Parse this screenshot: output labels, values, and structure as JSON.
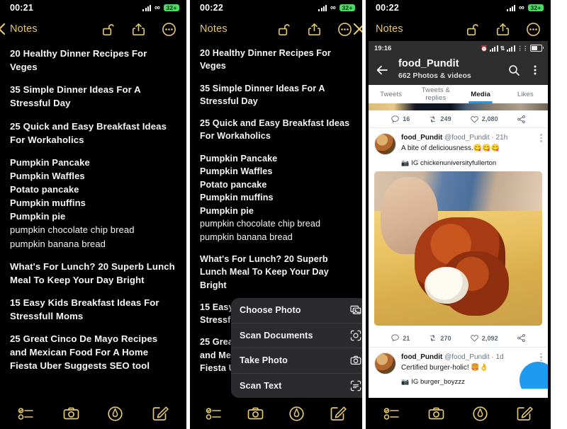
{
  "panels": [
    {
      "id": "panel-1",
      "status": {
        "time": "00:21",
        "battery": "32+",
        "signal_icon": "cellular-signal-icon",
        "wifi_icon": "infinity-icon"
      },
      "nav": {
        "title": "Notes",
        "lock_icon": "unlocked-padlock-icon",
        "share_icon": "share-icon",
        "more_icon": "more-ellipsis-icon",
        "back_icon": "chevron-left-icon"
      },
      "note": {
        "paragraphs": [
          "20 Healthy Dinner Recipes For Veges",
          "35 Simple Dinner Ideas For A Stressful Day",
          "25 Quick and Easy Breakfast Ideas For Workaholics"
        ],
        "list": [
          "Pumpkin Pancake",
          "Pumpkin Waffles",
          "Potato pancake",
          "Pumpkin muffins",
          "Pumpkin pie",
          "pumpkin chocolate chip bread",
          "pumpkin banana bread"
        ],
        "paragraphs2": [
          "What's For Lunch? 20 Superb Lunch Meal To Keep Your Day Bright",
          "15 Easy Kids Breakfast Ideas For Stressfull Moms",
          "25 Great Cinco De Mayo Recipes and Mexican Food For A Home Fiesta Uber Suggests SEO tool"
        ]
      },
      "toolbar": {
        "checklist_icon": "checklist-icon",
        "camera_icon": "camera-icon",
        "markup_icon": "markup-pen-icon",
        "compose_icon": "compose-icon"
      }
    },
    {
      "id": "panel-2",
      "status": {
        "time": "00:22",
        "battery": "32+"
      },
      "nav": {
        "title": "Notes",
        "close_icon": "close-x-icon"
      },
      "menu": {
        "items": [
          {
            "label": "Choose Photo",
            "icon": "photo-library-icon"
          },
          {
            "label": "Scan Documents",
            "icon": "scan-document-icon"
          },
          {
            "label": "Take Photo",
            "icon": "camera-icon"
          },
          {
            "label": "Scan Text",
            "icon": "scan-text-icon"
          }
        ]
      }
    },
    {
      "id": "panel-3",
      "status": {
        "time": "00:22",
        "battery": "32+"
      },
      "nav": {
        "title": "Notes"
      },
      "twitter": {
        "status": {
          "time": "19:16"
        },
        "header": {
          "name": "food_Pundit",
          "subtitle": "662 Photos & videos",
          "back_icon": "arrow-left-icon",
          "search_icon": "search-icon",
          "more_icon": "kebab-menu-icon"
        },
        "tabs": [
          {
            "label": "Tweets",
            "active": false
          },
          {
            "label": "Tweets & replies",
            "active": false
          },
          {
            "label": "Media",
            "active": true
          },
          {
            "label": "Likes",
            "active": false
          }
        ],
        "actions_top": {
          "replies": "16",
          "retweets": "249",
          "likes": "2,080",
          "share_icon": "share-icon"
        },
        "tweets": [
          {
            "user": "food_Pundit",
            "handle": "@food_Pundit",
            "separator": "·",
            "time": "21h",
            "text": "A bite of deliciousness.😋😋😋",
            "credit": "IG chickenuniversityfullerton",
            "credit_icon": "camera-emoji",
            "actions": {
              "replies": "21",
              "retweets": "270",
              "likes": "2,092",
              "share_icon": "share-icon"
            }
          },
          {
            "user": "food_Pundit",
            "handle": "@food_Pundit",
            "separator": "·",
            "time": "1d",
            "text": "Certified burger-holic! 🍔👌",
            "credit": "IG burger_boyzzz",
            "credit_icon": "camera-emoji"
          }
        ]
      }
    }
  ],
  "colors": {
    "accent_gold": "#e3c770",
    "note_bg": "#000000",
    "twitter_blue": "#1d9bf0",
    "battery_green": "#4cd964",
    "menu_bg": "#2b2b2d"
  }
}
